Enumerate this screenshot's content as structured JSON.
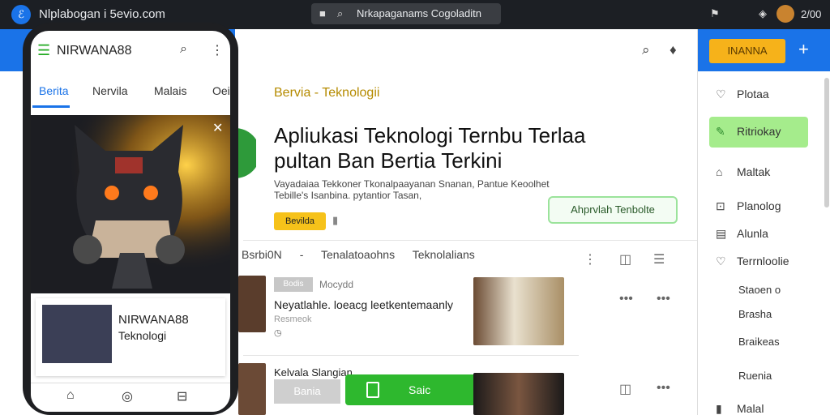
{
  "topbar": {
    "url": "Nlplabogan i 5evio.com",
    "tab_title": "Nrkapaganams Cogoladitn",
    "clock": "2/00",
    "icons": [
      "app-icon",
      "lock-icon",
      "search-icon",
      "flag-icon",
      "shield-icon"
    ]
  },
  "desktop": {
    "category": "Bervia - Teknologii",
    "headline": "Apliukasi Teknologi Ternbu Terlaa pultan Ban Bertia Terkini",
    "description": "Vayadaiaa Tekkoner Tkonalpaayanan Snanan, Pantue Keoolhet Tebille's Isanbina. pytantior Tasan,",
    "badge": "Bevilda",
    "outline_button": "Ahprvlah Tenbolte",
    "tabs": [
      "Bsrbi0N",
      "-",
      "Tenalatoaohns",
      "Teknolalians"
    ],
    "row1": {
      "tag": "Bodis",
      "source": "Mocydd",
      "title": "Neyatlahle. loeacg leetkentemaanly",
      "subtitle": "Resmeok"
    },
    "row2": {
      "title": "Kelvala Slangian",
      "grey_button": "Bania",
      "green_button": "Saic"
    }
  },
  "sidebar": {
    "button": "INANNA",
    "items": [
      {
        "label": "Plotaa",
        "icon": "heart-icon"
      },
      {
        "label": "Ritriokay",
        "icon": "pencil-icon"
      },
      {
        "label": "Maltak",
        "icon": "home-icon"
      },
      {
        "label": "Planolog",
        "icon": "clip-icon"
      },
      {
        "label": "Alunla",
        "icon": "list-icon"
      },
      {
        "label": "Terrnloolie",
        "icon": "heart-icon"
      }
    ],
    "subitems": [
      "Staoen  o",
      "Brasha",
      "Braikeas",
      "Ruenia",
      "Malal"
    ],
    "accent": "#a5ec8c"
  },
  "phone": {
    "brand": "NIRWANA88",
    "tabs": [
      "Berita",
      "Nervila",
      "Malais",
      "Oeis"
    ],
    "card": {
      "title": "NIRWANA88",
      "subtitle": "Teknologi"
    }
  }
}
